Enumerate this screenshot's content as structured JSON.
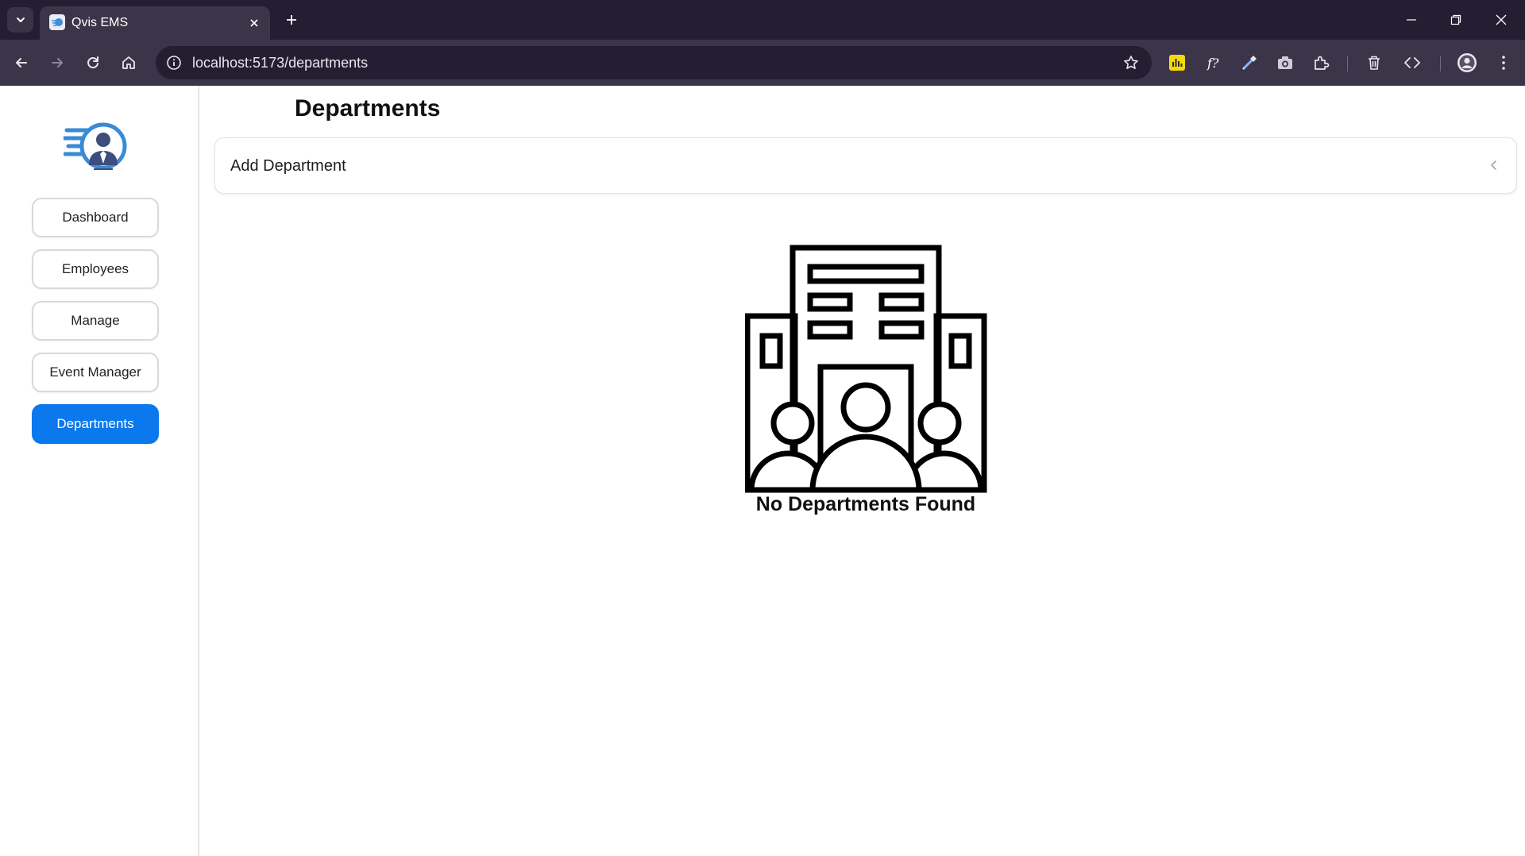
{
  "browser": {
    "tab_title": "Qvis EMS",
    "url": "localhost:5173/departments",
    "colors": {
      "tabstrip": "#241e33",
      "toolbar": "#3c3549"
    }
  },
  "sidebar": {
    "logo": "ems-logo",
    "items": [
      {
        "label": "Dashboard",
        "active": false
      },
      {
        "label": "Employees",
        "active": false
      },
      {
        "label": "Manage",
        "active": false
      },
      {
        "label": "Event Manager",
        "active": false
      },
      {
        "label": "Departments",
        "active": true
      }
    ]
  },
  "main": {
    "title": "Departments",
    "add_panel": {
      "label": "Add Department",
      "expanded": false
    },
    "empty_state": {
      "icon": "building-people-icon",
      "message": "No Departments Found"
    }
  },
  "colors": {
    "accent": "#0b78ee",
    "text": "#111111"
  }
}
